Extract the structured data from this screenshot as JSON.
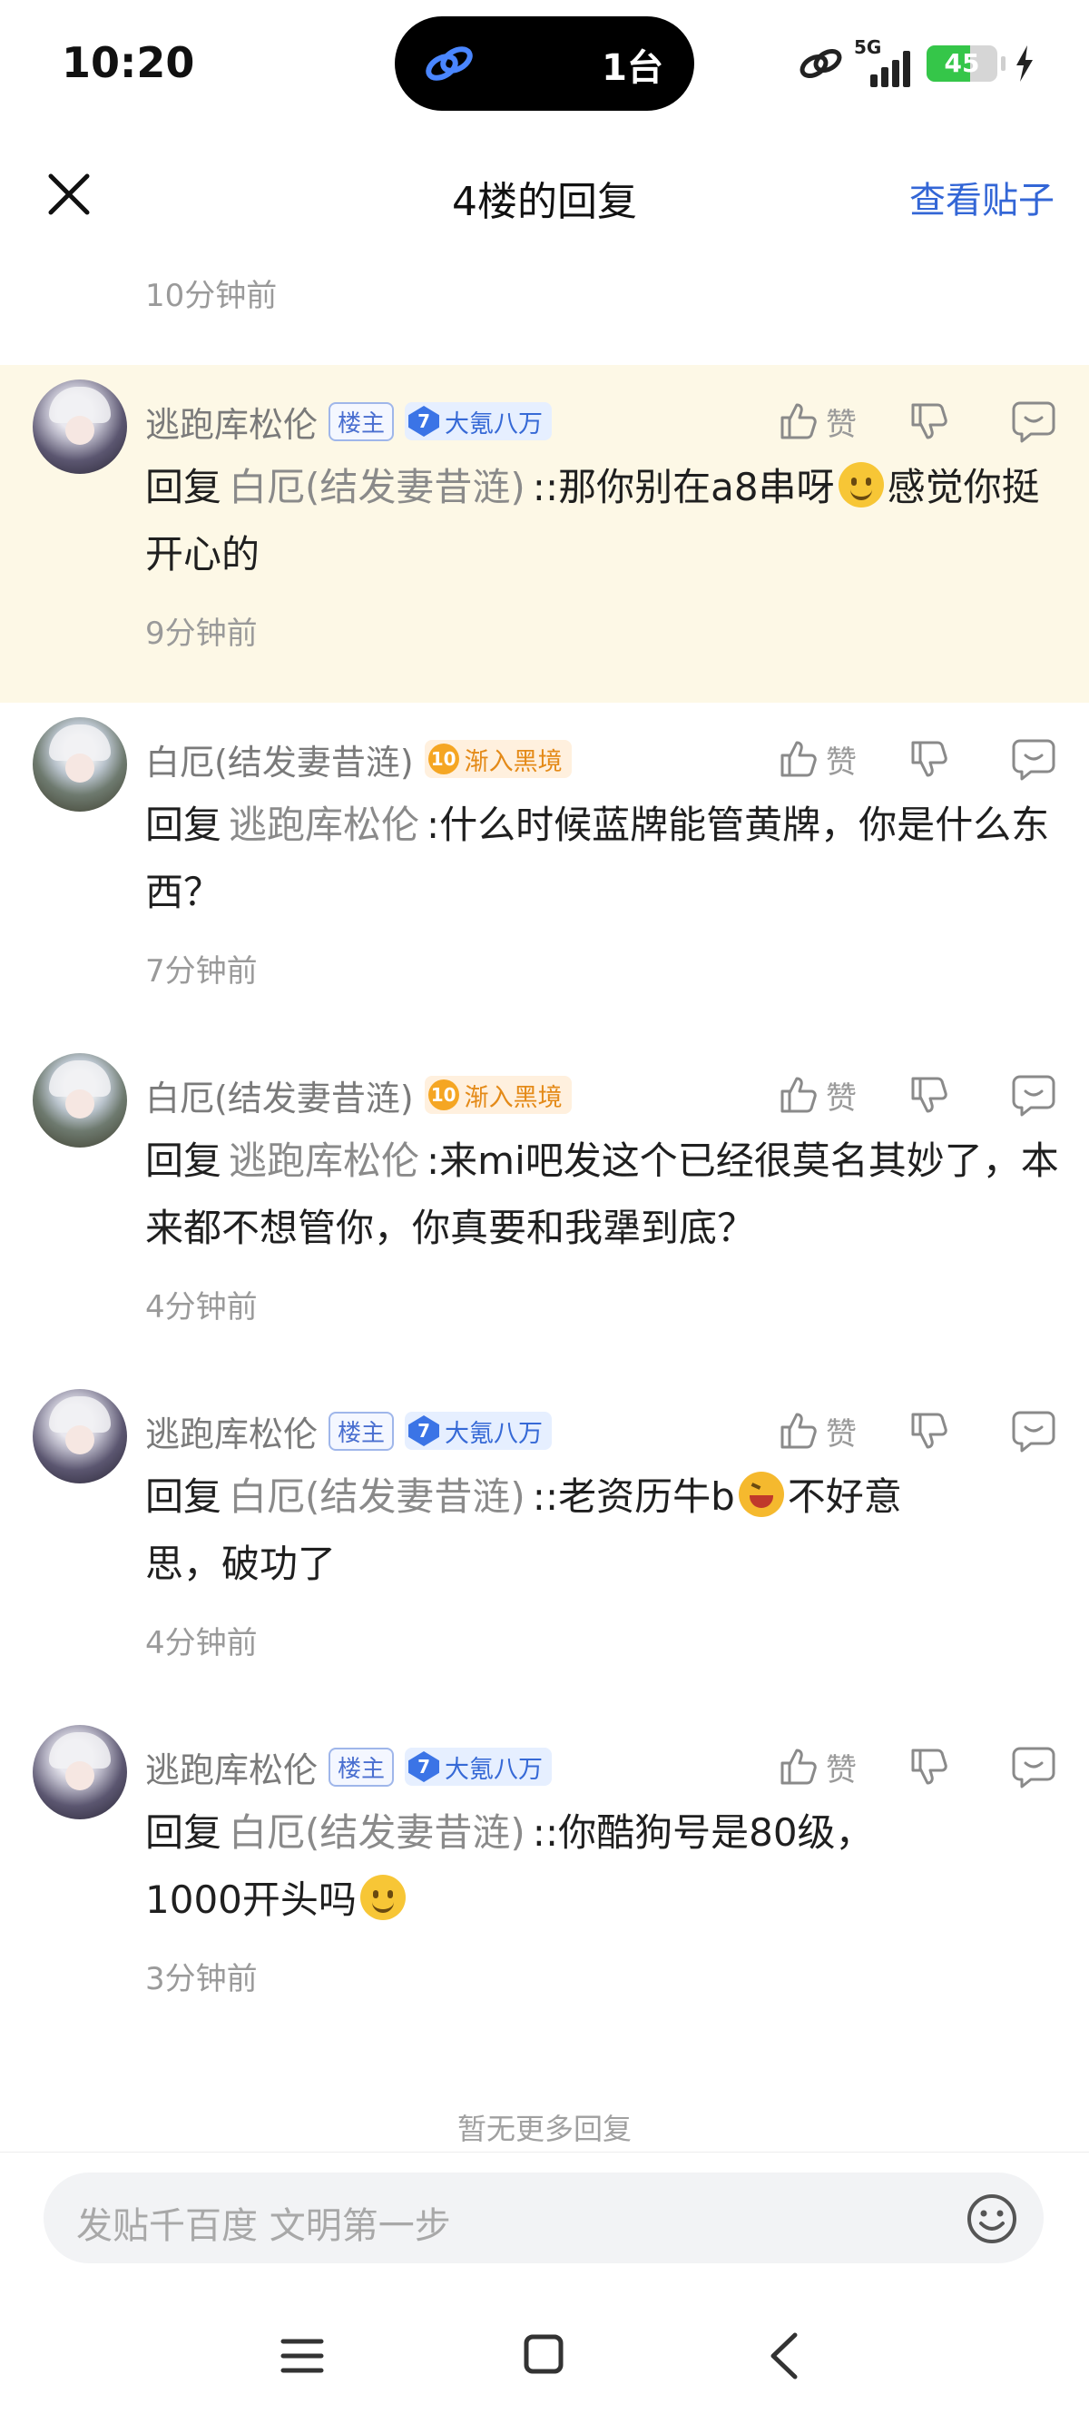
{
  "status_bar": {
    "time": "10:20",
    "island_text": "1台",
    "network": "5G",
    "battery": "45"
  },
  "header": {
    "title": "4楼的回复",
    "view_post": "查看贴子"
  },
  "top_time": "10分钟前",
  "replies": [
    {
      "username": "逃跑库松伦",
      "host_badge": "楼主",
      "level": "7",
      "level_title": "大氪八万",
      "like_label": "赞",
      "reply_word": "回复",
      "target": "白厄(结发妻昔涟)",
      "text_line1": "::那你别在a8串呀",
      "text_line2": "感觉你挺开心的",
      "emoji": "smile-emoji",
      "time": "9分钟前",
      "highlighted": true
    },
    {
      "username": "白厄(结发妻昔涟)",
      "level": "10",
      "level_title": "渐入黑境",
      "like_label": "赞",
      "reply_word": "回复",
      "target": "逃跑库松伦",
      "text_line1": ":什么时候蓝牌能管黄牌，你是",
      "text_line2": "什么东西？",
      "time": "7分钟前"
    },
    {
      "username": "白厄(结发妻昔涟)",
      "level": "10",
      "level_title": "渐入黑境",
      "like_label": "赞",
      "reply_word": "回复",
      "target": "逃跑库松伦",
      "text_line1": ":来mi吧发这个已经很莫名其",
      "text_line2": "妙了，本来都不想管你，你真要和我犟到底？",
      "time": "4分钟前"
    },
    {
      "username": "逃跑库松伦",
      "host_badge": "楼主",
      "level": "7",
      "level_title": "大氪八万",
      "like_label": "赞",
      "reply_word": "回复",
      "target": "白厄(结发妻昔涟)",
      "text_line1": "::老资历牛b",
      "text_line2": "不好意",
      "text_line3": "思，破功了",
      "emoji": "laugh-emoji",
      "time": "4分钟前"
    },
    {
      "username": "逃跑库松伦",
      "host_badge": "楼主",
      "level": "7",
      "level_title": "大氪八万",
      "like_label": "赞",
      "reply_word": "回复",
      "target": "白厄(结发妻昔涟)",
      "text_line1": "::你酷狗号是80级，",
      "text_line2": "1000开头吗",
      "emoji": "smile-emoji",
      "time": "3分钟前"
    }
  ],
  "no_more": "暂无更多回复",
  "input": {
    "placeholder": "发贴千百度 文明第一步"
  },
  "colors": {
    "accent": "#3366d6",
    "highlight_bg": "#fdf8e6",
    "muted": "#9a9a9a"
  }
}
